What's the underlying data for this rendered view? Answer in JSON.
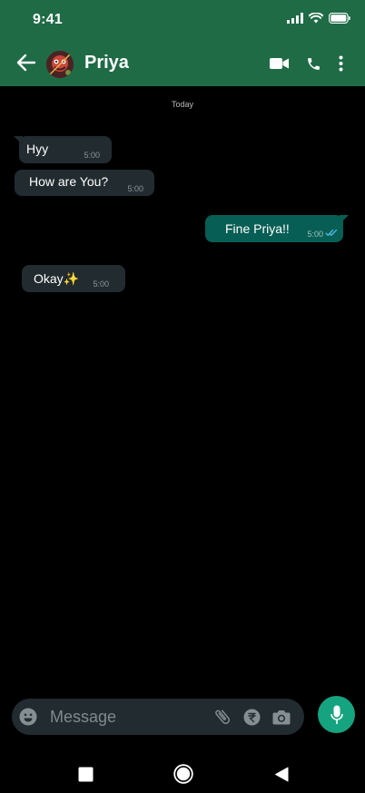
{
  "status_bar": {
    "time": "9:41",
    "icons": [
      "signal-icon",
      "wifi-icon",
      "battery-icon"
    ]
  },
  "header": {
    "contact_name": "Priya",
    "icons": [
      "back-arrow-icon",
      "avatar",
      "video-call-icon",
      "phone-call-icon",
      "more-options-icon"
    ]
  },
  "chat": {
    "date_label": "Today",
    "messages": [
      {
        "direction": "incoming",
        "text": "Hyy",
        "time": "5:00"
      },
      {
        "direction": "incoming",
        "text": "How are You?",
        "time": "5:00"
      },
      {
        "direction": "outgoing",
        "text": "Fine Priya!!",
        "time": "5:00",
        "status": "read"
      },
      {
        "direction": "incoming",
        "text": "Okay✨",
        "time": "5:00"
      }
    ]
  },
  "composer": {
    "placeholder": "Message",
    "icons": [
      "emoji-icon",
      "attach-icon",
      "rupee-payment-icon",
      "camera-icon",
      "mic-icon"
    ]
  },
  "nav_bar": {
    "icons": [
      "recents-square-icon",
      "home-circle-icon",
      "back-triangle-icon"
    ]
  },
  "colors": {
    "header_bg": "#1f6b46",
    "chat_bg": "#000000",
    "incoming_bubble": "#222b30",
    "outgoing_bubble": "#075e54",
    "mic_button": "#16a37f",
    "read_ticks": "#53bdeb"
  }
}
